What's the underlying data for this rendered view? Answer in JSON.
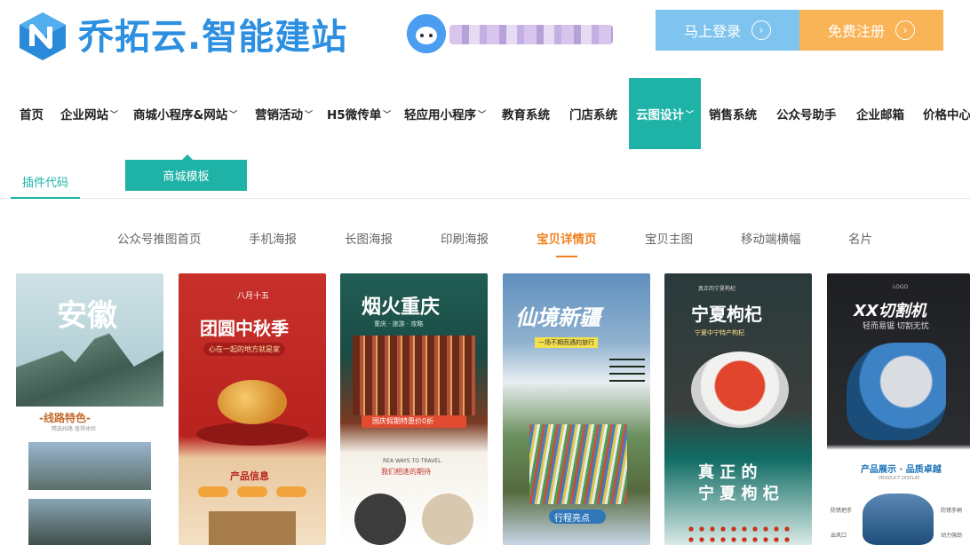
{
  "brand": {
    "name": "乔拓云.智能建站",
    "logo_icon": "n-logo-icon"
  },
  "header": {
    "login_label": "马上登录",
    "register_label": "免费注册",
    "colors": {
      "login_bg": "#7fc4ee",
      "register_bg": "#f9b457",
      "brand": "#2c8fe0"
    }
  },
  "nav": {
    "items": [
      {
        "label": "首页",
        "dropdown": false
      },
      {
        "label": "企业网站",
        "dropdown": true
      },
      {
        "label": "商城小程序&网站",
        "dropdown": true
      },
      {
        "label": "营销活动",
        "dropdown": true
      },
      {
        "label": "H5微传单",
        "dropdown": true
      },
      {
        "label": "轻应用小程序",
        "dropdown": true
      },
      {
        "label": "教育系统",
        "dropdown": false
      },
      {
        "label": "门店系统",
        "dropdown": false
      },
      {
        "label": "云图设计",
        "dropdown": true,
        "active": true
      },
      {
        "label": "销售系统",
        "dropdown": false
      },
      {
        "label": "公众号助手",
        "dropdown": false
      },
      {
        "label": "企业邮箱",
        "dropdown": false
      },
      {
        "label": "价格中心",
        "dropdown": false
      }
    ],
    "active_color": "#1fb3a8"
  },
  "subnav": {
    "plugin_code": "插件代码",
    "mall_template": "商城模板"
  },
  "categories": [
    {
      "label": "公众号推图首页"
    },
    {
      "label": "手机海报"
    },
    {
      "label": "长图海报"
    },
    {
      "label": "印刷海报"
    },
    {
      "label": "宝贝详情页",
      "active": true
    },
    {
      "label": "宝贝主图"
    },
    {
      "label": "移动端横幅"
    },
    {
      "label": "名片"
    }
  ],
  "cards": [
    {
      "title": "安徽",
      "section": "-线路特色-",
      "note": "精选线路 值得体验"
    },
    {
      "top": "八月十五",
      "title": "团圆中秋季",
      "slogan": "心在一起的地方就是家",
      "section": "产品信息"
    },
    {
      "title": "烟火重庆",
      "sub": "重庆 · 旅游 · 攻略",
      "banner": "国庆假期特惠价0折",
      "en": "REA WAYS TO TRAVEL",
      "tagline": "我们相逢的期待"
    },
    {
      "title": "仙境新疆",
      "tag": "一场不期而遇的旅行",
      "button": "行程亮点"
    },
    {
      "top": "真正的宁夏枸杞",
      "title": "宁夏枸杞",
      "sub": "宁夏中宁特产枸杞",
      "title2a": "真 正 的",
      "title2b": "宁 夏 枸 杞"
    },
    {
      "logo": "LOGO",
      "title": "XX切割机",
      "sub": "轻而易锯 切割无忧",
      "section": "产品展示 · 品质卓越",
      "section_en": "PRODUCT DISPLAY",
      "labels": [
        "防锈把手",
        "出风口",
        "防锈手柄",
        "动力强劲"
      ]
    }
  ]
}
